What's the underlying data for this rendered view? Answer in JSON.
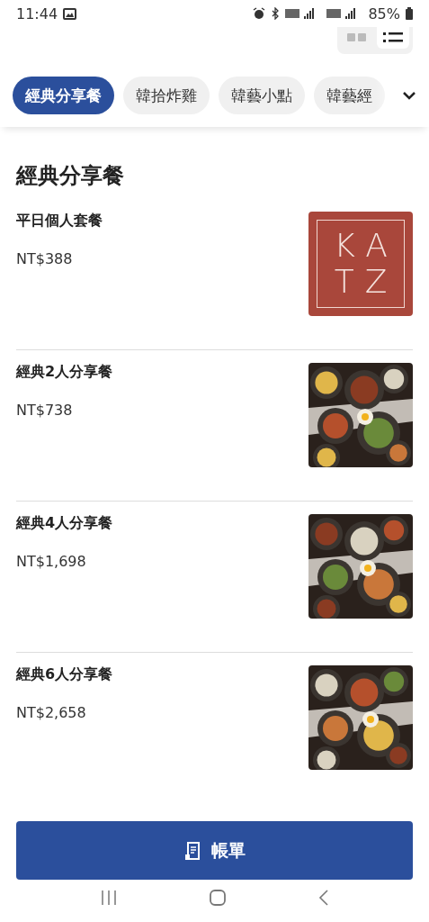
{
  "status_bar": {
    "time": "11:44",
    "battery": "85%"
  },
  "view_toggle": [
    {
      "kind": "grid",
      "selected": false
    },
    {
      "kind": "list",
      "selected": true
    }
  ],
  "tabs": [
    {
      "label": "經典分享餐",
      "selected": true
    },
    {
      "label": "韓拾炸雞",
      "selected": false
    },
    {
      "label": "韓藝小點",
      "selected": false
    },
    {
      "label": "韓藝經",
      "selected": false
    }
  ],
  "section_title": "經典分享餐",
  "items": [
    {
      "name": "平日個人套餐",
      "price": "NT$388",
      "image": {
        "kind": "logo",
        "lines": [
          "KA",
          "TZ"
        ]
      }
    },
    {
      "name": "經典2人分享餐",
      "price": "NT$738"
    },
    {
      "name": "經典4人分享餐",
      "price": "NT$1,698"
    },
    {
      "name": "經典6人分享餐",
      "price": "NT$2,658"
    }
  ],
  "bill_button": {
    "label": "帳單"
  }
}
